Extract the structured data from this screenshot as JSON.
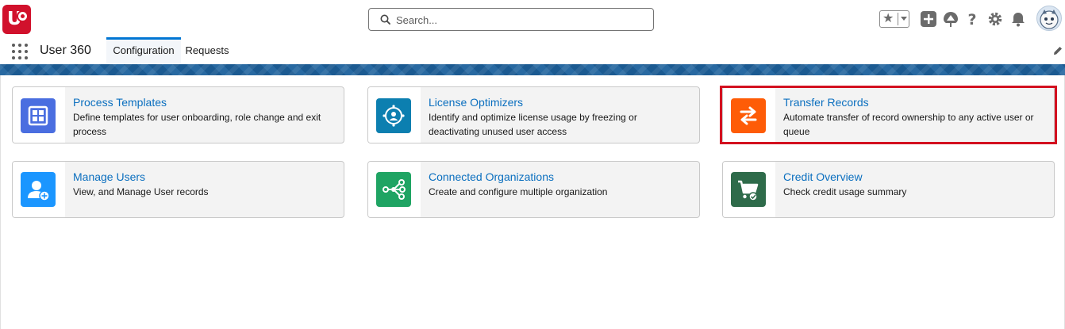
{
  "search": {
    "placeholder": "Search..."
  },
  "app": {
    "name": "User 360"
  },
  "tabs": [
    {
      "label": "Configuration",
      "active": true
    },
    {
      "label": "Requests",
      "active": false
    }
  ],
  "header_icons": [
    "favorites-star-icon",
    "add-icon",
    "trailhead-icon",
    "help-icon",
    "setup-gear-icon",
    "notifications-bell-icon"
  ],
  "cards": [
    {
      "title": "Process Templates",
      "description": "Define templates for user onboarding, role change and exit process",
      "icon": "grid-template-icon",
      "color": "#4a6ee0"
    },
    {
      "title": "License Optimizers",
      "description": "Identify and optimize license usage by freezing or deactivating unused user access",
      "icon": "license-optimize-icon",
      "color": "#0c7fb0"
    },
    {
      "title": "Transfer Records",
      "description": "Automate transfer of record ownership to any active user or queue",
      "icon": "transfer-arrows-icon",
      "color": "#fe5c07",
      "highlighted": true
    },
    {
      "title": "Manage Users",
      "description": "View, and Manage User records",
      "icon": "user-add-icon",
      "color": "#1b96ff"
    },
    {
      "title": "Connected Organizations",
      "description": "Create and configure multiple organization",
      "icon": "connected-nodes-icon",
      "color": "#1fa463"
    },
    {
      "title": "Credit Overview",
      "description": "Check credit usage summary",
      "icon": "cart-check-icon",
      "color": "#2e6b4a"
    }
  ],
  "colors": {
    "brand_red": "#d1112c",
    "link_blue": "#0b6fbf",
    "tab_active": "#0176d3",
    "highlight_border": "#d3101f"
  }
}
